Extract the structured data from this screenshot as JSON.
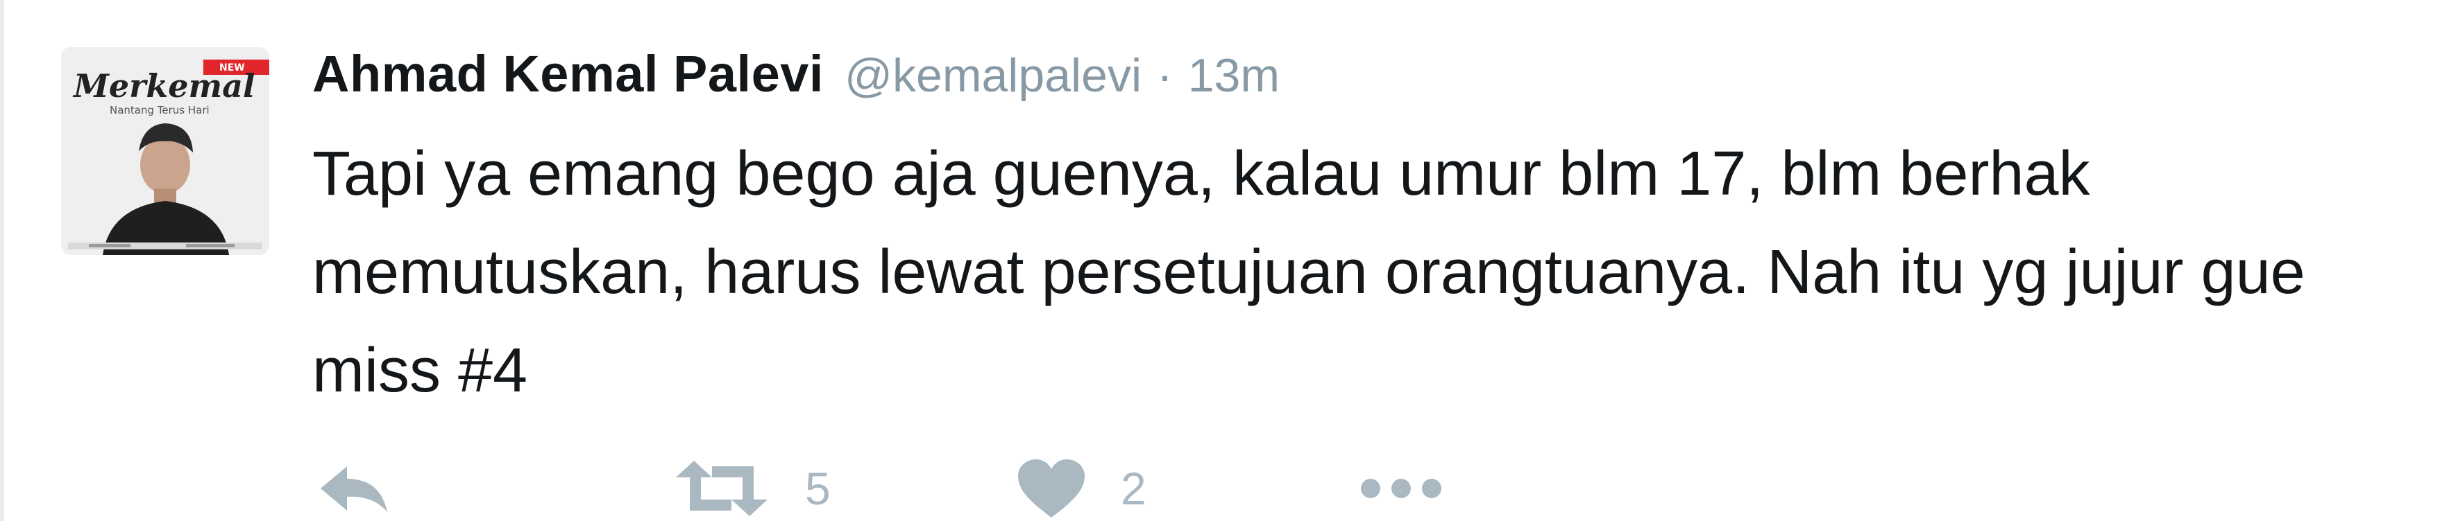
{
  "tweet": {
    "display_name": "Ahmad Kemal Palevi",
    "handle": "@kemalpalevi",
    "separator": "·",
    "time": "13m",
    "text": "Tapi ya emang bego aja guenya, kalau umur blm 17, blm berhak memutuskan, harus lewat persetujuan orangtuanya. Nah itu yg jujur gue miss #4",
    "avatar": {
      "title_text": "Merkemal",
      "subtitle_text": "Nantang Terus Hari",
      "badge_text": "NEW"
    },
    "actions": {
      "reply_icon": "reply-icon",
      "retweet_icon": "retweet-icon",
      "retweet_count": "5",
      "like_icon": "heart-icon",
      "like_count": "2",
      "more_icon": "more-icon"
    }
  },
  "colors": {
    "text": "#14171a",
    "secondary": "#8899a6",
    "action": "#aab8c2",
    "avatar_accent": "#e0262a"
  }
}
